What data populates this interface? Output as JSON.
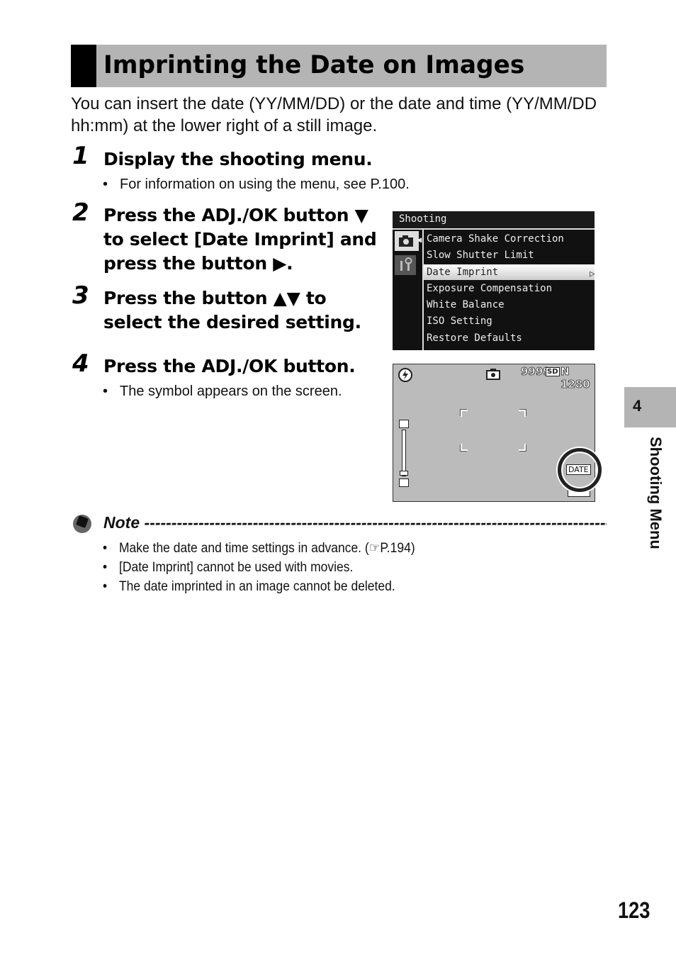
{
  "title": "Imprinting the Date on Images",
  "intro": "You can insert the date (YY/MM/DD) or the date and time (YY/MM/DD hh:mm) at the lower right of a still image.",
  "steps": [
    {
      "num": "1",
      "text": "Display the shooting menu.",
      "bullet": "For information on using the menu, see P.100."
    },
    {
      "num": "2",
      "text": "Press the ADJ./OK button ▼ to select [Date Imprint] and press the button ▶."
    },
    {
      "num": "3",
      "text": "Press the button ▲▼ to select the desired setting."
    },
    {
      "num": "4",
      "text": "Press the ADJ./OK button.",
      "bullet": "The symbol appears on the screen."
    }
  ],
  "menu_screen": {
    "header": "Shooting",
    "items": [
      "Camera Shake Correction",
      "Slow Shutter Limit",
      "Date Imprint",
      "Exposure Compensation",
      "White Balance",
      "ISO Setting",
      "Restore Defaults"
    ],
    "selected_index": 2
  },
  "shoot_screen": {
    "shots_remaining": "9999",
    "media": "SD",
    "quality_size": "N 1280",
    "date_label": "DATE"
  },
  "note": {
    "title": "Note",
    "bullets": [
      "Make the date and time settings in advance. (☞P.194)",
      "[Date Imprint] cannot be used with movies.",
      "The date imprinted in an image cannot be deleted."
    ]
  },
  "side_tab": {
    "chapter": "4",
    "label": "Shooting Menu"
  },
  "page_number": "123"
}
